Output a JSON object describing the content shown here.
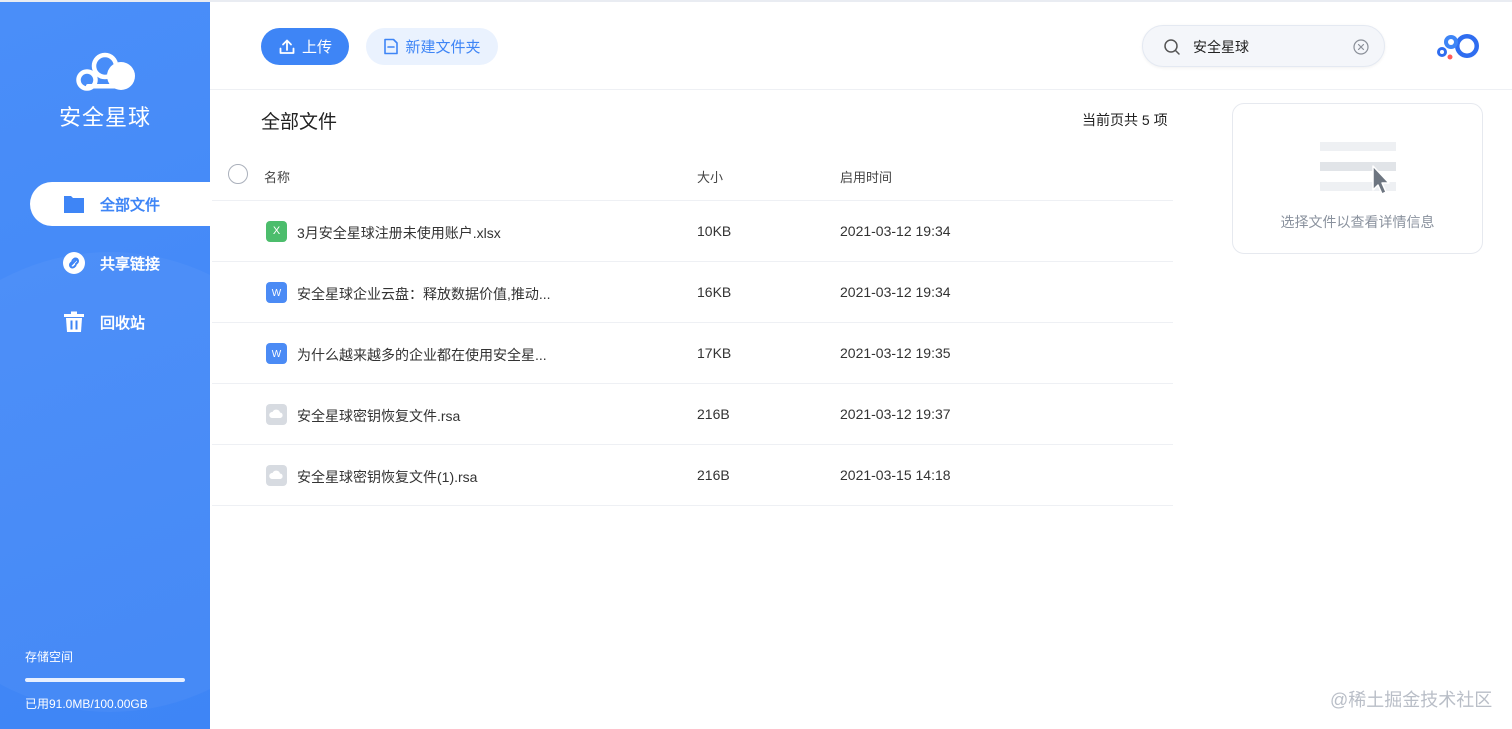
{
  "app": {
    "logo_text": "安全星球"
  },
  "sidebar": {
    "items": [
      {
        "label": "全部文件",
        "icon": "folder-icon",
        "active": true
      },
      {
        "label": "共享链接",
        "icon": "link-icon",
        "active": false
      },
      {
        "label": "回收站",
        "icon": "trash-icon",
        "active": false
      }
    ],
    "storage": {
      "label": "存储空间",
      "used_text": "已用91.0MB/100.00GB",
      "used_fraction": 0.999
    }
  },
  "toolbar": {
    "upload_label": "上传",
    "new_folder_label": "新建文件夹"
  },
  "search": {
    "value": "安全星球"
  },
  "main": {
    "title": "全部文件",
    "count_text": "当前页共 5 项",
    "columns": {
      "name": "名称",
      "size": "大小",
      "time": "启用时间"
    },
    "rows": [
      {
        "icon": "excel",
        "icon_char": "X",
        "name": "3月安全星球注册未使用账户.xlsx",
        "size": "10KB",
        "time": "2021-03-12 19:34"
      },
      {
        "icon": "word",
        "icon_char": "W",
        "name": "安全星球企业云盘：释放数据价值,推动...",
        "size": "16KB",
        "time": "2021-03-12 19:34"
      },
      {
        "icon": "word",
        "icon_char": "W",
        "name": "为什么越来越多的企业都在使用安全星...",
        "size": "17KB",
        "time": "2021-03-12 19:35"
      },
      {
        "icon": "generic",
        "icon_char": "",
        "name": "安全星球密钥恢复文件.rsa",
        "size": "216B",
        "time": "2021-03-12 19:37"
      },
      {
        "icon": "generic",
        "icon_char": "",
        "name": "安全星球密钥恢复文件(1).rsa",
        "size": "216B",
        "time": "2021-03-15 14:18"
      }
    ]
  },
  "detail": {
    "empty_text": "选择文件以查看详情信息"
  },
  "watermark": "@稀土掘金技术社区",
  "colors": {
    "brand": "#3e85f6",
    "brand_light": "#eaf2fe",
    "excel": "#4cbd6c",
    "word": "#4b8bf5"
  }
}
